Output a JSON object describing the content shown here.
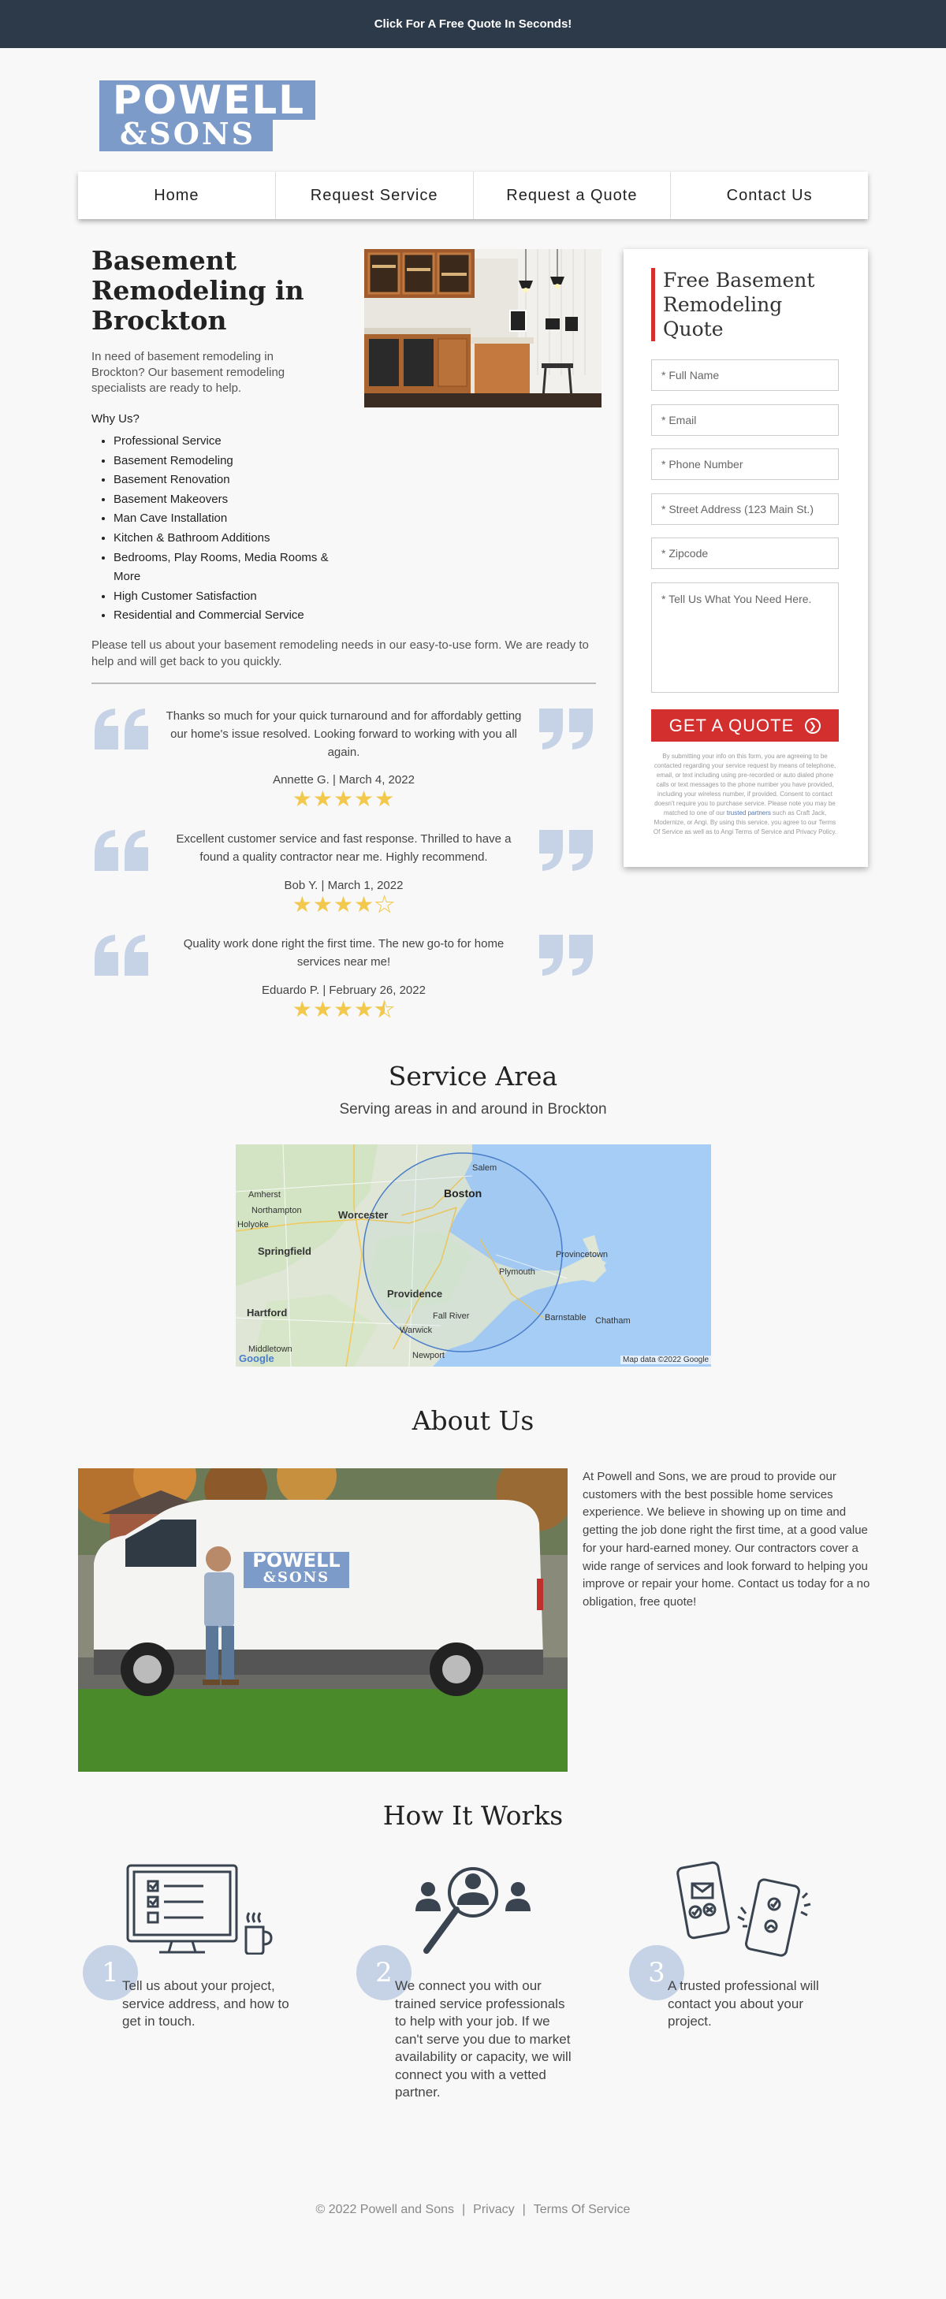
{
  "topbar": {
    "cta": "Click For A Free Quote In Seconds!"
  },
  "logo": {
    "line1": "POWELL",
    "line2": "&SONS"
  },
  "nav": [
    "Home",
    "Request Service",
    "Request a Quote",
    "Contact Us"
  ],
  "main": {
    "title": "Basement Remodeling in Brockton",
    "intro": "In need of basement remodeling in Brockton? Our basement remodeling specialists are ready to help.",
    "why_heading": "Why Us?",
    "why_items": [
      "Professional Service",
      "Basement Remodeling",
      "Basement Renovation",
      "Basement Makeovers",
      "Man Cave Installation",
      "Kitchen & Bathroom Additions",
      "Bedrooms, Play Rooms, Media Rooms & More",
      "High Customer Satisfaction",
      "Residential and Commercial Service"
    ],
    "closing": "Please tell us about your basement remodeling needs in our easy-to-use form. We are ready to help and will get back to you quickly."
  },
  "form": {
    "title": "Free Basement Remodeling Quote",
    "placeholders": {
      "full_name": "* Full Name",
      "email": "* Email",
      "phone": "* Phone Number",
      "address": "* Street Address (123 Main St.)",
      "zipcode": "* Zipcode",
      "message": "* Tell Us What You Need Here."
    },
    "submit_label": "GET A QUOTE",
    "disclaimer_before": "By submitting your info on this form, you are agreeing to be contacted regarding your service request by means of telephone, email, or text including using pre-recorded or auto dialed phone calls or text messages to the phone number you have provided, including your wireless number, if provided. Consent to contact doesn't require you to purchase service. Please note you may be matched to one of our ",
    "disclaimer_link": "trusted partners",
    "disclaimer_after": " such as Craft Jack, Modernize, or Angi. By using this service, you agree to our Terms Of Service as well as to Angi Terms of Service and Privacy Policy."
  },
  "reviews": [
    {
      "text": "Thanks so much for your quick turnaround and for affordably getting our home's issue resolved. Looking forward to working with you all again.",
      "author": "Annette G. | March 4, 2022",
      "rating": 5
    },
    {
      "text": "Excellent customer service and fast response. Thrilled to have a found a quality contractor near me. Highly recommend.",
      "author": "Bob Y. | March 1, 2022",
      "rating": 4
    },
    {
      "text": "Quality work done right the first time. The new go-to for home services near me!",
      "author": "Eduardo P. | February 26, 2022",
      "rating": 4.5
    }
  ],
  "service_area": {
    "title": "Service Area",
    "subtitle": "Serving areas in and around in Brockton",
    "map_labels": [
      "Salem",
      "Amherst",
      "Northampton",
      "Worcester",
      "Boston",
      "Holyoke",
      "Springfield",
      "Provincetown",
      "Plymouth",
      "Providence",
      "Hartford",
      "Fall River",
      "Barnstable",
      "Chatham",
      "Warwick",
      "Middletown",
      "Newport"
    ],
    "map_data": "Map data ©2022 Google",
    "google": "Google"
  },
  "about": {
    "title": "About Us",
    "text": "At Powell and Sons, we are proud to provide our customers with the best possible home services experience. We believe in showing up on time and getting the job done right the first time, at a good value for your hard-earned money. Our contractors cover a wide range of services and look forward to helping you improve or repair your home. Contact us today for a no obligation, free quote!",
    "van_logo_line1": "POWELL",
    "van_logo_line2": "&SONS"
  },
  "how_it_works": {
    "title": "How It Works",
    "steps": [
      {
        "num": "1",
        "text": "Tell us about your project, service address, and how to get in touch."
      },
      {
        "num": "2",
        "text": "We connect you with our trained service professionals to help with your job. If we can't serve you due to market availability or capacity, we will connect you with a vetted partner."
      },
      {
        "num": "3",
        "text": "A trusted professional will contact you about your project."
      }
    ]
  },
  "footer": {
    "copyright": "© 2022 Powell and Sons",
    "privacy": "Privacy",
    "terms": "Terms Of Service"
  },
  "colors": {
    "topbar": "#2c3a4a",
    "brand_blue": "#7d9bc9",
    "accent_red": "#d32f2f",
    "star": "#f2c94c",
    "quote_mark": "#c6d3e6"
  }
}
